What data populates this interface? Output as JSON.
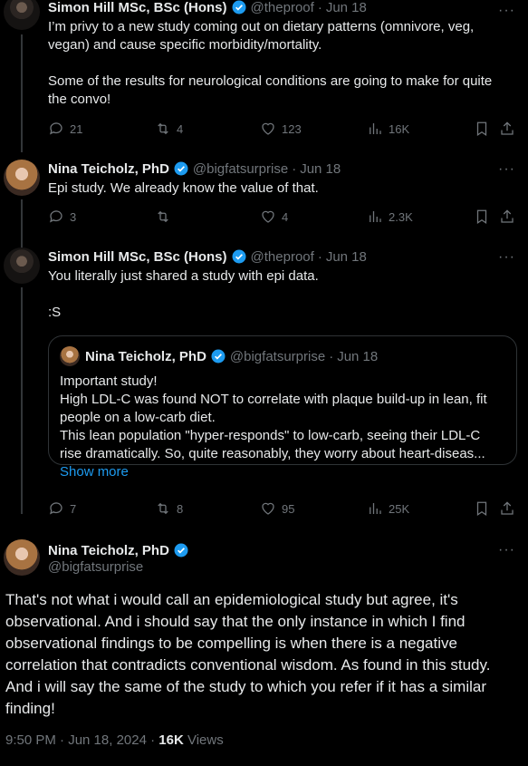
{
  "tweets": [
    {
      "name": "Simon Hill MSc, BSc (Hons)",
      "handle": "@theproof",
      "date": "Jun 18",
      "lines": [
        "I’m privy to a new study coming out on dietary patterns (omnivore, veg,",
        "vegan) and cause specific morbidity/mortality.",
        "",
        "Some of the results for neurological conditions are going to make for quite",
        "the convo!"
      ],
      "replies": "21",
      "reposts": "4",
      "likes": "123",
      "views": "16K"
    },
    {
      "name": "Nina Teicholz, PhD",
      "handle": "@bigfatsurprise",
      "date": "Jun 18",
      "lines": [
        "Epi study. We already know the value of that."
      ],
      "replies": "3",
      "reposts": "",
      "likes": "4",
      "views": "2.3K"
    },
    {
      "name": "Simon Hill MSc, BSc (Hons)",
      "handle": "@theproof",
      "date": "Jun 18",
      "lines": [
        "You literally just shared a study with epi data.",
        "",
        ":S"
      ],
      "replies": "7",
      "reposts": "8",
      "likes": "95",
      "views": "25K"
    }
  ],
  "quote": {
    "name": "Nina Teicholz, PhD",
    "handle": "@bigfatsurprise",
    "date": "Jun 18",
    "lines": [
      "Important study!",
      "High LDL-C was found NOT to correlate with plaque build-up in lean, fit",
      "people on a low-carb diet.",
      "This lean population \"hyper-responds\" to low-carb, seeing their LDL-C",
      "rise dramatically. So, quite reasonably, they worry about heart-diseas..."
    ],
    "show_more": "Show more"
  },
  "main": {
    "name": "Nina Teicholz, PhD",
    "handle": "@bigfatsurprise",
    "lines": [
      "That's not what i would call an epidemiological study but agree, it's",
      "observational. And i should say that the only instance in which I find",
      "observational findings to be compelling is when there is a negative",
      "correlation that contradicts conventional wisdom. As found in this study.",
      "And i will say the same of the study to which you refer if it has a similar",
      "finding!"
    ],
    "time": "9:50 PM · Jun 18, 2024 · ",
    "views_count": "16K",
    "views_label": " Views"
  },
  "colors": {
    "background": "#000000",
    "accent": "#1d9bf0",
    "muted": "#71767b",
    "text": "#e7e9ea"
  }
}
